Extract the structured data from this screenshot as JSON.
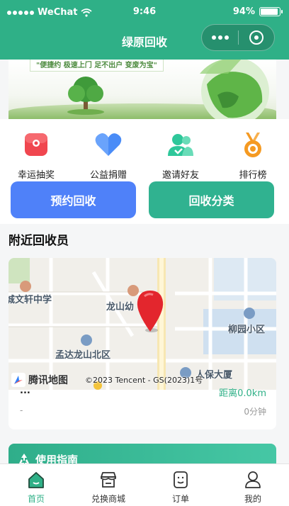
{
  "status_bar": {
    "carrier": "WeChat",
    "time": "9:46",
    "battery": "94%",
    "battery_level": 0.94
  },
  "nav": {
    "title": "绿原回收"
  },
  "banner": {
    "slogan": "\"便捷约 极速上门 足不出户 变废为宝\""
  },
  "quick_menu": [
    {
      "label": "幸运抽奖",
      "icon": "lucky-draw-icon",
      "color": "#f0464f"
    },
    {
      "label": "公益捐赠",
      "icon": "heart-icon",
      "color": "#4a8cf7"
    },
    {
      "label": "邀请好友",
      "icon": "invite-friends-icon",
      "color": "#2ec79a"
    },
    {
      "label": "排行榜",
      "icon": "medal-icon",
      "color": "#f59a22"
    }
  ],
  "actions": {
    "book": "预约回收",
    "category": "回收分类"
  },
  "nearby": {
    "title": "附近回收员",
    "map": {
      "pois": [
        "城文轩中学",
        "龙山幼",
        "柳园小区",
        "孟达龙山北区",
        "人保大厦"
      ],
      "logo": "腾讯地图",
      "copyright": "©2023 Tencent - GS(2023)1号"
    },
    "collector_name": "...",
    "distance": "距离0.0km",
    "left_value": "-",
    "eta": "0分钟"
  },
  "guide": {
    "title": "使用指南"
  },
  "tabbar": [
    {
      "label": "首页",
      "icon": "home-icon",
      "active": true
    },
    {
      "label": "兑换商城",
      "icon": "shop-icon",
      "active": false
    },
    {
      "label": "订单",
      "icon": "order-icon",
      "active": false
    },
    {
      "label": "我的",
      "icon": "profile-icon",
      "active": false
    }
  ],
  "colors": {
    "brand": "#2fb087",
    "book_button": "#4f81f9",
    "category_button": "#30b290"
  }
}
